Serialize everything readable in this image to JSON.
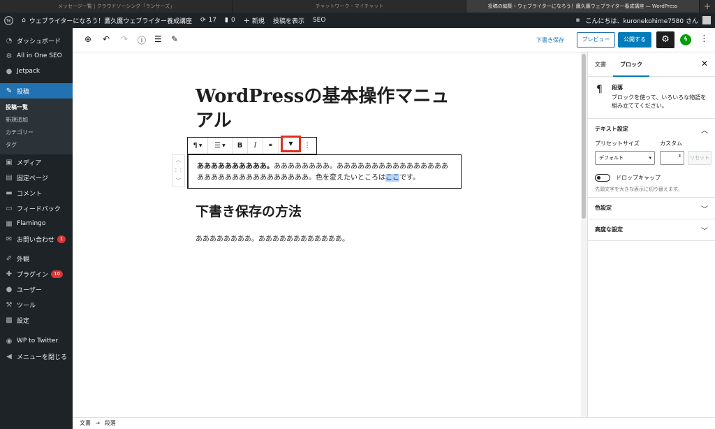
{
  "browser": {
    "tabs": [
      "メッセージ一覧 | クラウドソーシング「ランサーズ」",
      "チャットワーク - マイチャット",
      "投稿の編集 ‹ ウェブライターになろう！鷹久鷹ウェブライター養成講座 — WordPress"
    ],
    "new_tab": "+"
  },
  "adminbar": {
    "site": "ウェブライターになろう！鷹久鷹ウェブライター養成講座",
    "updates": "17",
    "comments": "0",
    "new": "新規",
    "view_post": "投稿を表示",
    "seo": "SEO",
    "greeting": "こんにちは、kuronekohime7580 さん"
  },
  "sidebar": {
    "items": [
      {
        "icon": "dashboard-icon",
        "label": "ダッシュボード"
      },
      {
        "icon": "gear-icon",
        "label": "All in One SEO"
      },
      {
        "icon": "jetpack-icon",
        "label": "Jetpack"
      },
      {
        "icon": "pin-icon",
        "label": "投稿"
      }
    ],
    "submenu": [
      "投稿一覧",
      "新規追加",
      "カテゴリー",
      "タグ"
    ],
    "items2": [
      {
        "icon": "media-icon",
        "label": "メディア"
      },
      {
        "icon": "page-icon",
        "label": "固定ページ"
      },
      {
        "icon": "comment-icon",
        "label": "コメント"
      },
      {
        "icon": "feedback-icon",
        "label": "フィードバック"
      },
      {
        "icon": "flamingo-icon",
        "label": "Flamingo"
      },
      {
        "icon": "mail-icon",
        "label": "お問い合わせ",
        "badge": "1"
      },
      {
        "icon": "brush-icon",
        "label": "外観"
      },
      {
        "icon": "plugin-icon",
        "label": "プラグイン",
        "badge": "10"
      },
      {
        "icon": "user-icon",
        "label": "ユーザー"
      },
      {
        "icon": "wrench-icon",
        "label": "ツール"
      },
      {
        "icon": "settings-icon",
        "label": "設定"
      },
      {
        "icon": "twitter-icon",
        "label": "WP to Twitter"
      },
      {
        "icon": "collapse-icon",
        "label": "メニューを閉じる"
      }
    ]
  },
  "toolbar": {
    "save_draft": "下書き保存",
    "preview": "プレビュー",
    "publish": "公開する"
  },
  "editor": {
    "title": "WordPressの基本操作マニュアル",
    "para_bold": "ああああああああああ。",
    "para_text": "ああああああああ。ああああああああああああああああああああああああああああああああ。色を変えたいところは",
    "para_selected": "ここ",
    "para_end": "です。",
    "heading": "下書き保存の方法",
    "para2": "ああああああああ。ああああああああああああ。"
  },
  "breadcrumbs": {
    "root": "文書",
    "arrow": "→",
    "current": "段落"
  },
  "panel": {
    "tab_document": "文書",
    "tab_block": "ブロック",
    "block_name": "段落",
    "block_desc": "ブロックを使って、いろいろな物語を組み立ててください。",
    "text_settings": "テキスト設定",
    "preset_label": "プリセットサイズ",
    "custom_label": "カスタム",
    "preset_value": "デフォルト",
    "reset": "リセット",
    "dropcap": "ドロップキャップ",
    "dropcap_help": "先頭文字を大きな表示に切り替えます。",
    "color_settings": "色設定",
    "advanced": "高度な設定"
  }
}
